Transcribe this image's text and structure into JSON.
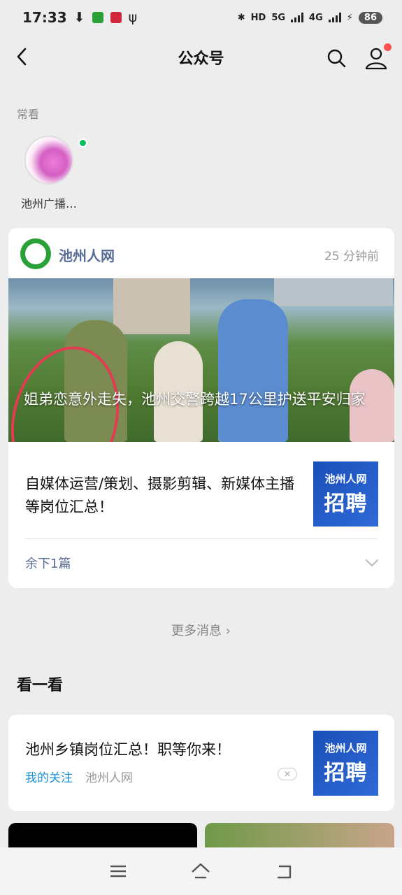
{
  "status_bar": {
    "time": "17:33",
    "network_hd": "HD",
    "network_5g": "5G",
    "network_4g": "4G",
    "battery": "86"
  },
  "nav": {
    "title": "公众号",
    "back_icon": "chevron-left-icon",
    "search_icon": "search-icon",
    "profile_icon": "profile-icon"
  },
  "frequent": {
    "label": "常看",
    "items": [
      {
        "name": "池州广播…"
      }
    ]
  },
  "feed_card": {
    "account": "池州人网",
    "time": "25 分钟前",
    "cover_title": "姐弟恋意外走失，池州交警跨越17公里护送平安归家",
    "article_title": "自媒体运营/策划、摄影剪辑、新媒体主播  等岗位汇总！",
    "thumb_line1": "池州人网",
    "thumb_line2": "招聘",
    "remaining": "余下1篇"
  },
  "more_messages": "更多消息",
  "look_section": {
    "heading": "看一看",
    "item": {
      "title": "池州乡镇岗位汇总！职等你来！",
      "tag": "我的关注",
      "source": "池州人网",
      "thumb_line1": "池州人网",
      "thumb_line2": "招聘"
    }
  },
  "colors": {
    "link": "#576b95",
    "accent_red": "#fa5151",
    "online_green": "#07c160",
    "thumb_blue": "#1a4fb8"
  }
}
